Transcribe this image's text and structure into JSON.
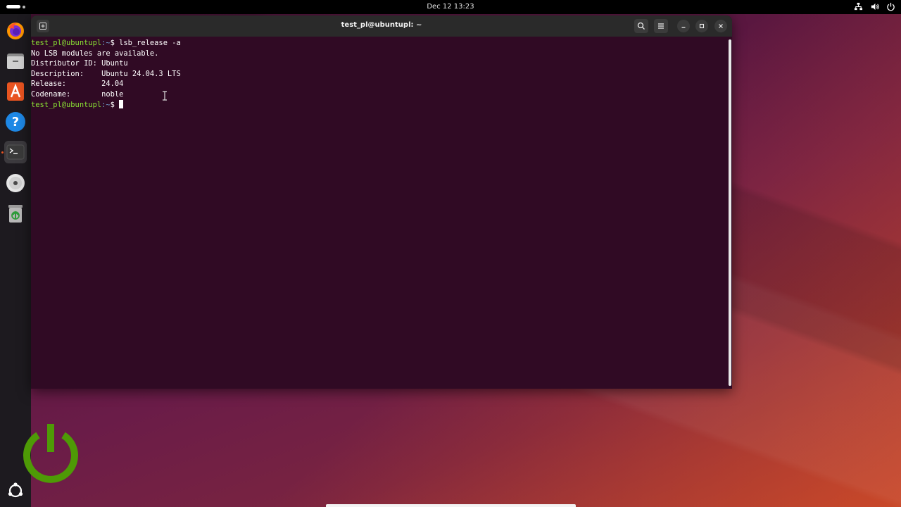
{
  "topbar": {
    "clock": "Dec 12  13:23"
  },
  "dock": {
    "items": [
      {
        "name": "firefox-icon"
      },
      {
        "name": "files-icon"
      },
      {
        "name": "app-center-icon"
      },
      {
        "name": "help-icon"
      },
      {
        "name": "terminal-icon"
      },
      {
        "name": "disc-icon"
      },
      {
        "name": "trash-icon"
      }
    ]
  },
  "terminal": {
    "title": "test_pl@ubuntupl: ~",
    "prompt_user": "test_pl@ubuntupl",
    "prompt_path": ":~",
    "prompt_symbol": "$",
    "command": " lsb_release -a",
    "output": [
      "No LSB modules are available.",
      "Distributor ID:\tUbuntu",
      "Description:\tUbuntu 24.04.3 LTS",
      "Release:\t24.04",
      "Codename:\tnoble"
    ]
  },
  "colors": {
    "terminal_bg": "#300a24",
    "prompt_user": "#8ae234",
    "prompt_path": "#729fcf",
    "accent": "#e95420",
    "power_logo": "#4e9a06"
  }
}
